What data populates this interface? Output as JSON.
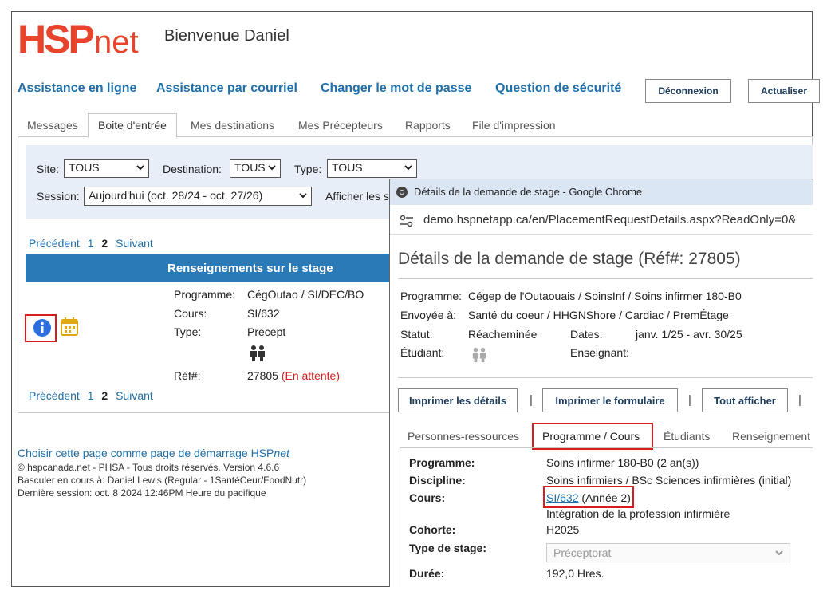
{
  "header": {
    "logo_text": "HSPnet",
    "welcome": "Bienvenue Daniel"
  },
  "topnav": {
    "links": [
      "Assistance en ligne",
      "Assistance par courriel",
      "Changer le mot de passe",
      "Question de sécurité"
    ],
    "logout": "Déconnexion",
    "refresh": "Actualiser"
  },
  "tabs": [
    "Messages",
    "Boite d'entrée",
    "Mes destinations",
    "Mes Précepteurs",
    "Rapports",
    "File d'impression"
  ],
  "filters": {
    "site_label": "Site:",
    "site_value": "TOUS",
    "destination_label": "Destination:",
    "destination_value": "TOUS",
    "type_label": "Type:",
    "type_value": "TOUS",
    "session_label": "Session:",
    "session_value": "Aujourd'hui (oct. 28/24 - oct. 27/26)",
    "afficher": "Afficher les s"
  },
  "pager": {
    "prev": "Précédent",
    "p1": "1",
    "p2": "2",
    "next": "Suivant"
  },
  "stage": {
    "header": "Renseignements sur le stage",
    "programme_label": "Programme:",
    "programme_value": "CégOutao / SI/DEC/BO",
    "cours_label": "Cours:",
    "cours_value": "SI/632",
    "type_label": "Type:",
    "type_value": "Precept",
    "ref_label": "Réf#:",
    "ref_value": "27805",
    "status": "(En attente)",
    "icons": [
      "info-icon",
      "calendar-icon",
      "people-icon"
    ]
  },
  "footer": {
    "startpage": "Choisir cette page comme page de démarrage HSP",
    "startpage_em": "net",
    "copyright": "© hspcanada.net - PHSA - Tous droits réservés.   Version 4.6.6",
    "switch": "Basculer en cours à: Daniel Lewis (Regular - 1SantéCeur/FoodNutr)",
    "last_session": "Dernière session: oct.  8 2024 12:46PM Heure du pacifique"
  },
  "popup": {
    "window_title": "Détails de la demande de stage - Google Chrome",
    "url": "demo.hspnetapp.ca/en/PlacementRequestDetails.aspx?ReadOnly=0&",
    "heading": "Détails de la demande de stage (Réf#: 27805)",
    "programme_label": "Programme:",
    "programme_value": "Cégep de l'Outaouais / SoinsInf / Soins infirmer 180-B0",
    "envoyee_label": "Envoyée à:",
    "envoyee_value": "Santé du coeur / HHGNShore / Cardiac / PremÉtage",
    "statut_label": "Statut:",
    "statut_value": "Réacheminée",
    "dates_label": "Dates:",
    "dates_value": "janv. 1/25 - avr. 30/25",
    "etudiant_label": "Étudiant:",
    "enseignant_label": "Enseignant:",
    "buttons": [
      "Imprimer les détails",
      "Imprimer le formulaire",
      "Tout afficher"
    ],
    "tabs": [
      "Personnes-ressources",
      "Programme / Cours",
      "Étudiants",
      "Renseignement"
    ],
    "details": {
      "programme_label": "Programme:",
      "programme_value": "Soins infirmer 180-B0 (2 an(s))",
      "discipline_label": "Discipline:",
      "discipline_value": "Soins infirmiers / BSc Sciences infirmières (initial)",
      "cours_label": "Cours:",
      "cours_link": "SI/632",
      "cours_year": "(Année 2)",
      "cours_name": "Intégration de la profession infirmière",
      "cohorte_label": "Cohorte:",
      "cohorte_value": "H2025",
      "type_label": "Type de stage:",
      "type_value": "Préceptorat",
      "duree_label": "Durée:",
      "duree_value": "192,0 Hres."
    }
  },
  "colors": {
    "brand_red": "#e8442c",
    "link_blue": "#1f6fa8",
    "header_blue": "#2a7ab8",
    "highlight_red": "#d61c1c"
  }
}
